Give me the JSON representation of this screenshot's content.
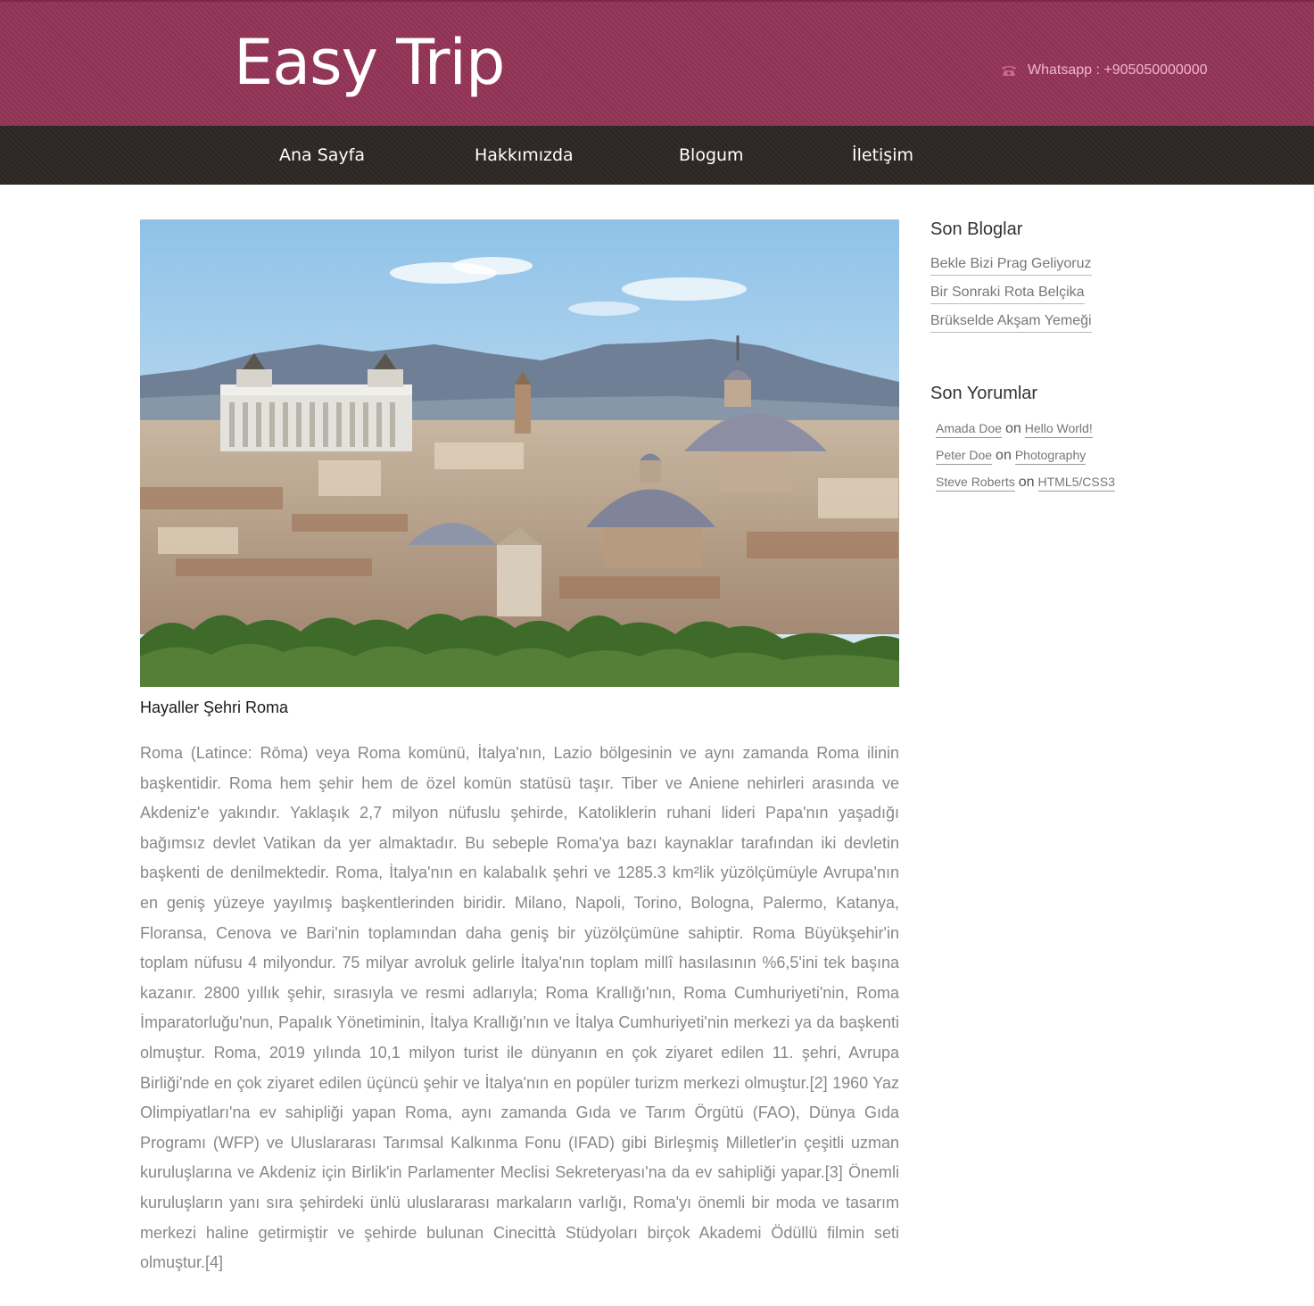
{
  "header": {
    "logo": "Easy Trip",
    "contact": "Whatsapp : +905050000000",
    "phone_icon": "phone-icon"
  },
  "nav": {
    "items": [
      {
        "label": "Ana Sayfa"
      },
      {
        "label": "Hakkımızda"
      },
      {
        "label": "Blogum"
      },
      {
        "label": "İletişim"
      }
    ]
  },
  "main": {
    "image_caption": "Hayaller Şehri Roma",
    "article_text": "Roma (Latince: Rōma) veya Roma komünü, İtalya'nın, Lazio bölgesinin ve aynı zamanda Roma ilinin başkentidir. Roma hem şehir hem de özel komün statüsü taşır. Tiber ve Aniene nehirleri arasında ve Akdeniz'e yakındır. Yaklaşık 2,7 milyon nüfuslu şehirde, Katoliklerin ruhani lideri Papa'nın yaşadığı bağımsız devlet Vatikan da yer almaktadır. Bu sebeple Roma'ya bazı kaynaklar tarafından iki devletin başkenti de denilmektedir. Roma, İtalya'nın en kalabalık şehri ve 1285.3 km²lik yüzölçümüyle Avrupa'nın en geniş yüzeye yayılmış başkentlerinden biridir. Milano, Napoli, Torino, Bologna, Palermo, Katanya, Floransa, Cenova ve Bari'nin toplamından daha geniş bir yüzölçümüne sahiptir. Roma Büyükşehir'in toplam nüfusu 4 milyondur. 75 milyar avroluk gelirle İtalya'nın toplam millî hasılasının %6,5'ini tek başına kazanır. 2800 yıllık şehir, sırasıyla ve resmi adlarıyla; Roma Krallığı'nın, Roma Cumhuriyeti'nin, Roma İmparatorluğu'nun, Papalık Yönetiminin, İtalya Krallığı'nın ve İtalya Cumhuriyeti'nin merkezi ya da başkenti olmuştur. Roma, 2019 yılında 10,1 milyon turist ile dünyanın en çok ziyaret edilen 11. şehri, Avrupa Birliği'nde en çok ziyaret edilen üçüncü şehir ve İtalya'nın en popüler turizm merkezi olmuştur.[2] 1960 Yaz Olimpiyatları'na ev sahipliği yapan Roma, aynı zamanda Gıda ve Tarım Örgütü (FAO), Dünya Gıda Programı (WFP) ve Uluslararası Tarımsal Kalkınma Fonu (IFAD) gibi Birleşmiş Milletler'in çeşitli uzman kuruluşlarına ve Akdeniz için Birlik'in Parlamenter Meclisi Sekreteryası'na da ev sahipliği yapar.[3] Önemli kuruluşların yanı sıra şehirdeki ünlü uluslararası markaların varlığı, Roma'yı önemli bir moda ve tasarım merkezi haline getirmiştir ve şehirde bulunan Cinecittà Stüdyoları birçok Akademi Ödüllü filmin seti olmuştur.[4]"
  },
  "sidebar": {
    "blogs_title": "Son Bloglar",
    "blogs": [
      {
        "label": "Bekle Bizi Prag Geliyoruz"
      },
      {
        "label": "Bir Sonraki Rota Belçika"
      },
      {
        "label": "Brükselde Akşam Yemeği"
      }
    ],
    "comments_title": "Son Yorumlar",
    "comments": [
      {
        "author": "Amada Doe",
        "on": "on",
        "post": "Hello World!"
      },
      {
        "author": "Peter Doe",
        "on": "on",
        "post": "Photography"
      },
      {
        "author": "Steve Roberts",
        "on": "on",
        "post": "HTML5/CSS3"
      }
    ]
  },
  "colors": {
    "header_bg": "#923456",
    "nav_bg": "#2f2626",
    "contact_text": "#f2b6cb",
    "article_text": "#888888"
  }
}
